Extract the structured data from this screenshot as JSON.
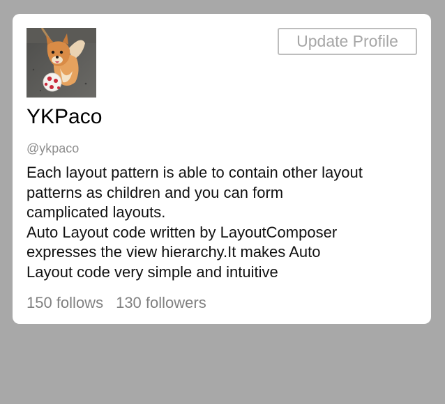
{
  "profile": {
    "name": "YKPaco",
    "handle": "@ykpaco",
    "update_button_label": "Update Profile",
    "bio_lines": [
      "Each layout pattern is able to contain other layout",
      "patterns as children and you can form",
      "camplicated layouts.",
      "Auto Layout code written by LayoutComposer",
      "expresses the view hierarchy.It makes Auto",
      "Layout code very simple and intuitive"
    ],
    "follows_label": "150 follows",
    "followers_label": "130 followers",
    "avatar_icon": "dog-with-ball-photo"
  },
  "colors": {
    "background": "#a8a8a8",
    "card": "#ffffff",
    "button_border": "#bdbdbd",
    "button_text": "#a6a6a6",
    "handle_text": "#8e8e8e",
    "stats_text": "#808080"
  }
}
